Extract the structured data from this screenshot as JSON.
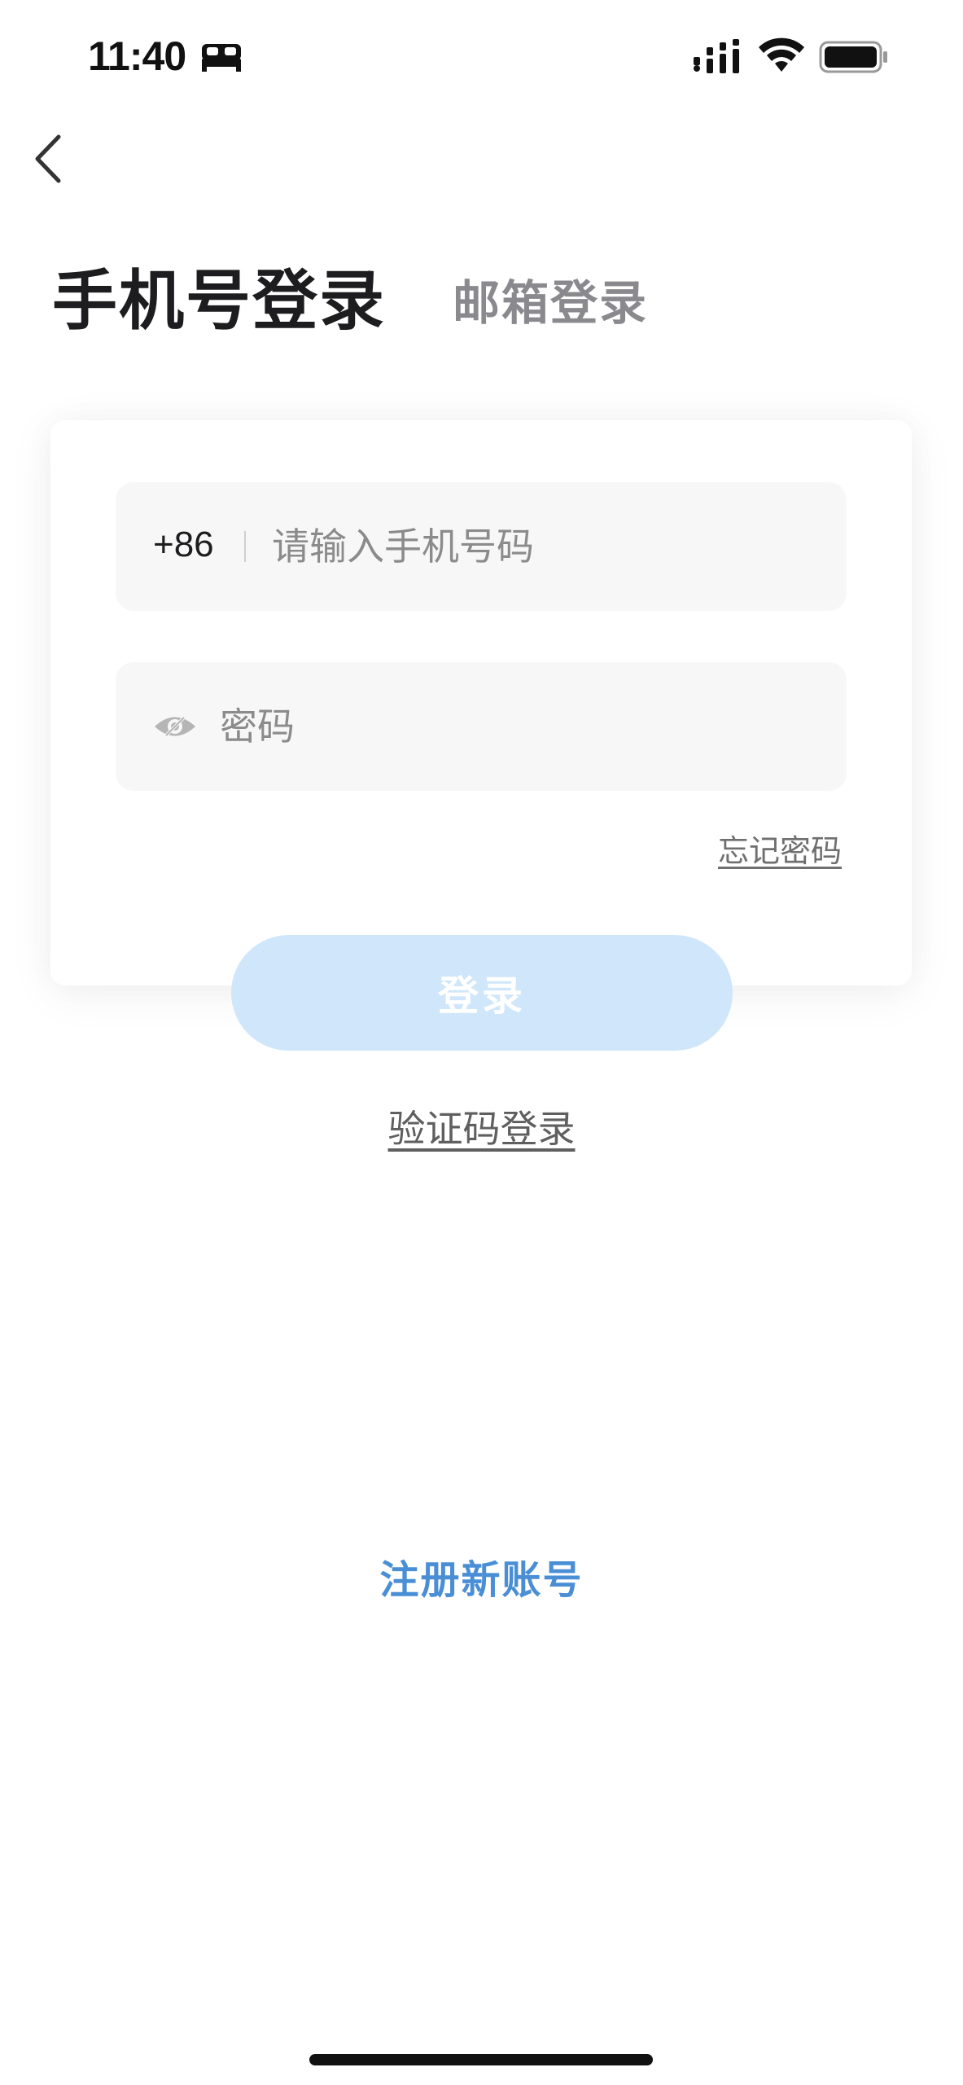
{
  "status_bar": {
    "time": "11:40",
    "icons": [
      "bed-icon",
      "signal-icon",
      "wifi-icon",
      "battery-icon"
    ]
  },
  "nav": {
    "back_icon": "chevron-left-icon"
  },
  "tabs": {
    "phone_login": "手机号登录",
    "email_login": "邮箱登录"
  },
  "form": {
    "country_code": "+86",
    "phone_placeholder": "请输入手机号码",
    "phone_value": "",
    "password_placeholder": "密码",
    "password_value": "",
    "password_toggle_icon": "eye-off-icon",
    "forgot_password": "忘记密码",
    "login_button": "登录"
  },
  "links": {
    "sms_login": "验证码登录",
    "register": "注册新账号"
  },
  "colors": {
    "accent": "#4a8fd6",
    "login_button_disabled": "#cfe6fb",
    "field_background": "#f7f7f7"
  }
}
